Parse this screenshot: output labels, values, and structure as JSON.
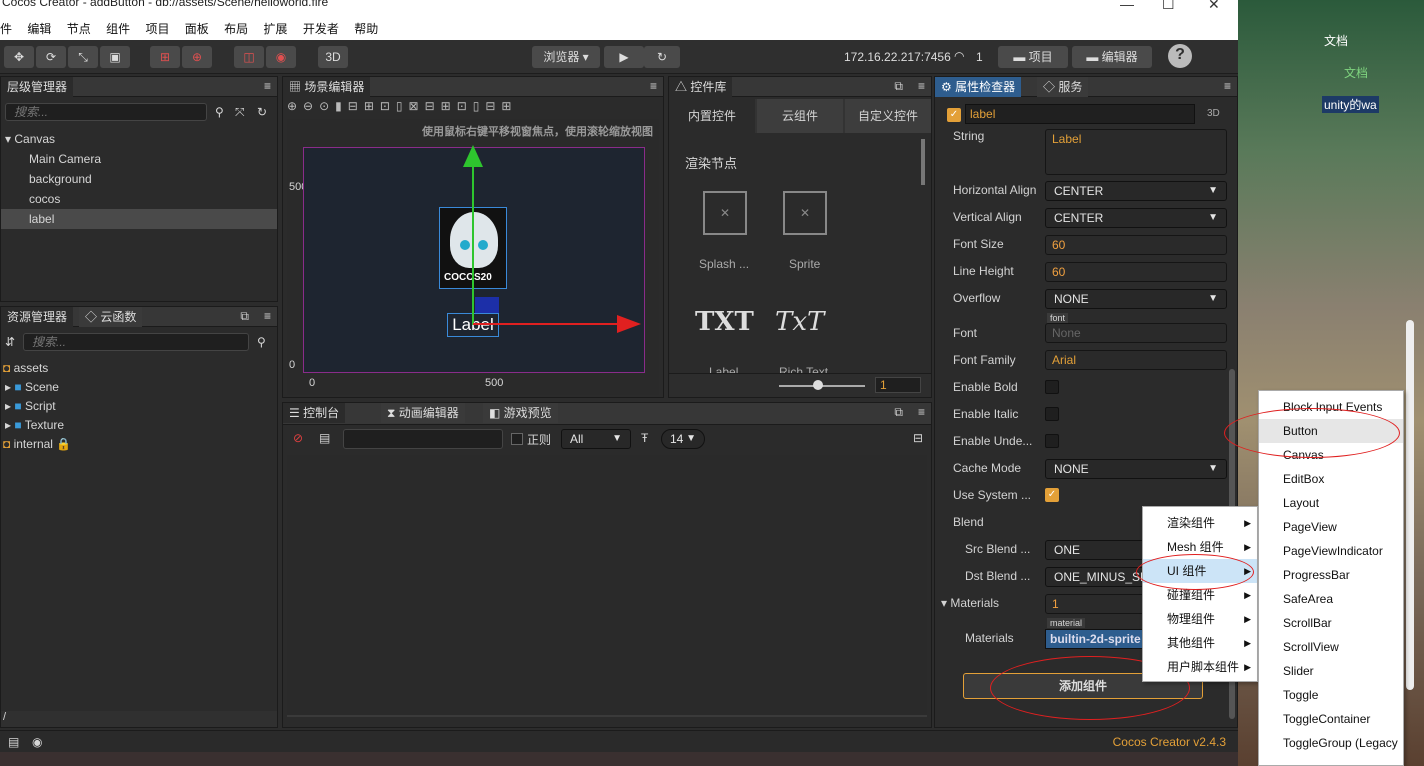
{
  "window": {
    "title": "Cocos Creator - addButton - db://assets/Scene/helloworld.fire",
    "min": "—",
    "max": "☐",
    "close": "✕"
  },
  "menubar": [
    "件",
    "编辑",
    "节点",
    "组件",
    "项目",
    "面板",
    "布局",
    "扩展",
    "开发者",
    "帮助"
  ],
  "toolbar": {
    "mode_3d": "3D",
    "browser": "浏览器 ▾",
    "ip": "172.16.22.217:7456",
    "conn_count": "1",
    "project_btn": "项目",
    "editor_btn": "编辑器",
    "help": "?"
  },
  "hierarchy": {
    "title": "层级管理器",
    "search_placeholder": "搜索...",
    "nodes": [
      "Canvas",
      "Main Camera",
      "background",
      "cocos",
      "label"
    ]
  },
  "assets": {
    "tab1": "资源管理器",
    "tab2": "云函数",
    "search_placeholder": "搜索...",
    "items": [
      "assets",
      "Scene",
      "Script",
      "Texture",
      "internal"
    ],
    "footer": "/"
  },
  "scene": {
    "title": "场景编辑器",
    "hint": "使用鼠标右键平移视窗焦点，使用滚轮缩放视图",
    "y500": "500",
    "y0": "0",
    "x0": "0",
    "x500": "500",
    "logo_text": "COCOS20",
    "label_text": "Label"
  },
  "library": {
    "title": "控件库",
    "tabs": [
      "内置控件",
      "云组件",
      "自定义控件"
    ],
    "section": "渲染节点",
    "items": [
      "Splash ...",
      "Sprite",
      "Label",
      "Rich Text"
    ],
    "icon_txt": "TXT",
    "icon_rich": "TxT",
    "zoom_value": "1"
  },
  "console": {
    "tabs": [
      "控制台",
      "动画编辑器",
      "游戏预览"
    ],
    "regex": "正则",
    "filter": "All",
    "font_size": "14"
  },
  "inspector": {
    "tab1": "属性检查器",
    "tab2": "服务",
    "node_name": "label",
    "badge_3d": "3D",
    "props": {
      "string_label": "String",
      "string_value": "Label",
      "halign_label": "Horizontal Align",
      "halign_value": "CENTER",
      "valign_label": "Vertical Align",
      "valign_value": "CENTER",
      "fontsize_label": "Font Size",
      "fontsize_value": "60",
      "lineheight_label": "Line Height",
      "lineheight_value": "60",
      "overflow_label": "Overflow",
      "overflow_value": "NONE",
      "font_label": "Font",
      "font_tag": "font",
      "font_value": "None",
      "family_label": "Font Family",
      "family_value": "Arial",
      "bold_label": "Enable Bold",
      "italic_label": "Enable Italic",
      "underline_label": "Enable Unde...",
      "cache_label": "Cache Mode",
      "cache_value": "NONE",
      "usesys_label": "Use System ...",
      "blend_label": "Blend",
      "src_label": "Src Blend ...",
      "src_value": "ONE",
      "dst_label": "Dst Blend ...",
      "dst_value": "ONE_MINUS_SR",
      "materials_label": "Materials",
      "materials_count": "1",
      "material_tag": "material",
      "materials_item_label": "Materials",
      "material_value": "builtin-2d-sprite"
    },
    "add_component": "添加组件",
    "version": "Cocos Creator v2.4.3"
  },
  "context_menu": {
    "items": [
      "渲染组件",
      "Mesh 组件",
      "UI 组件",
      "碰撞组件",
      "物理组件",
      "其他组件",
      "用户脚本组件"
    ]
  },
  "ui_submenu": {
    "items": [
      "Block Input Events",
      "Button",
      "Canvas",
      "EditBox",
      "Layout",
      "PageView",
      "PageViewIndicator",
      "ProgressBar",
      "SafeArea",
      "ScrollBar",
      "ScrollView",
      "Slider",
      "Toggle",
      "ToggleContainer",
      "ToggleGroup (Legacy"
    ]
  },
  "desktop": {
    "doc1": "文档",
    "doc2": "文档",
    "file": "unity的wa"
  },
  "colors": {
    "accent": "#e3a038",
    "panel": "#2b2b2b",
    "highlight": "#2e5d8e",
    "annotation": "#e02020"
  }
}
